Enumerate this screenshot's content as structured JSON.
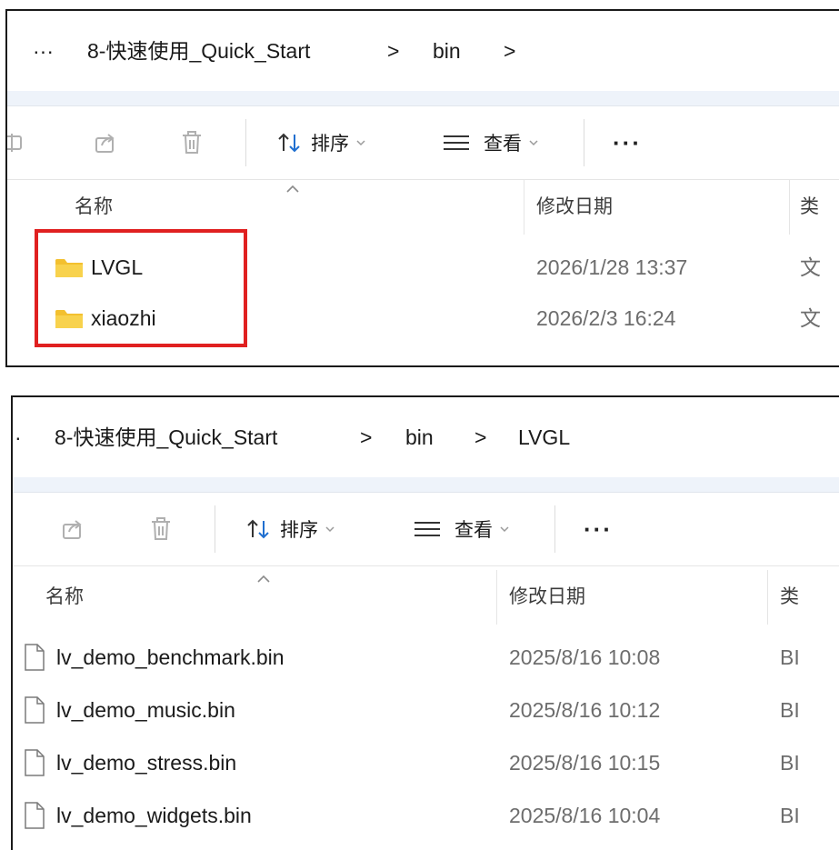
{
  "panel1": {
    "breadcrumb": {
      "overflow": "···",
      "items": [
        "8-快速使用_Quick_Start",
        "bin"
      ],
      "sep": ">"
    },
    "toolbar": {
      "icons": [
        "rename-icon",
        "share-icon",
        "delete-icon"
      ],
      "sort_label": "排序",
      "view_label": "查看",
      "more_label": "···"
    },
    "columns": {
      "name": "名称",
      "modified": "修改日期",
      "type": "类"
    },
    "rows": [
      {
        "name": "LVGL",
        "modified": "2026/1/28 13:37",
        "type": "文",
        "icon": "folder-icon"
      },
      {
        "name": "xiaozhi",
        "modified": "2026/2/3 16:24",
        "type": "文",
        "icon": "folder-icon"
      }
    ],
    "highlight_color": "#e02020"
  },
  "panel2": {
    "breadcrumb": {
      "overflow": "·",
      "items": [
        "8-快速使用_Quick_Start",
        "bin",
        "LVGL"
      ],
      "sep": ">"
    },
    "toolbar": {
      "icons": [
        "share-icon",
        "delete-icon"
      ],
      "sort_label": "排序",
      "view_label": "查看",
      "more_label": "···"
    },
    "columns": {
      "name": "名称",
      "modified": "修改日期",
      "type": "类"
    },
    "rows": [
      {
        "name": "lv_demo_benchmark.bin",
        "modified": "2025/8/16 10:08",
        "type": "BI",
        "icon": "file-icon"
      },
      {
        "name": "lv_demo_music.bin",
        "modified": "2025/8/16 10:12",
        "type": "BI",
        "icon": "file-icon"
      },
      {
        "name": "lv_demo_stress.bin",
        "modified": "2025/8/16 10:15",
        "type": "BI",
        "icon": "file-icon"
      },
      {
        "name": "lv_demo_widgets.bin",
        "modified": "2025/8/16 10:04",
        "type": "BI",
        "icon": "file-icon"
      }
    ]
  },
  "colors": {
    "strip": "#eef3fa",
    "sort_accent": "#1f6fd0",
    "folder": "#f3c02f",
    "date_text": "#6d6d6d"
  }
}
